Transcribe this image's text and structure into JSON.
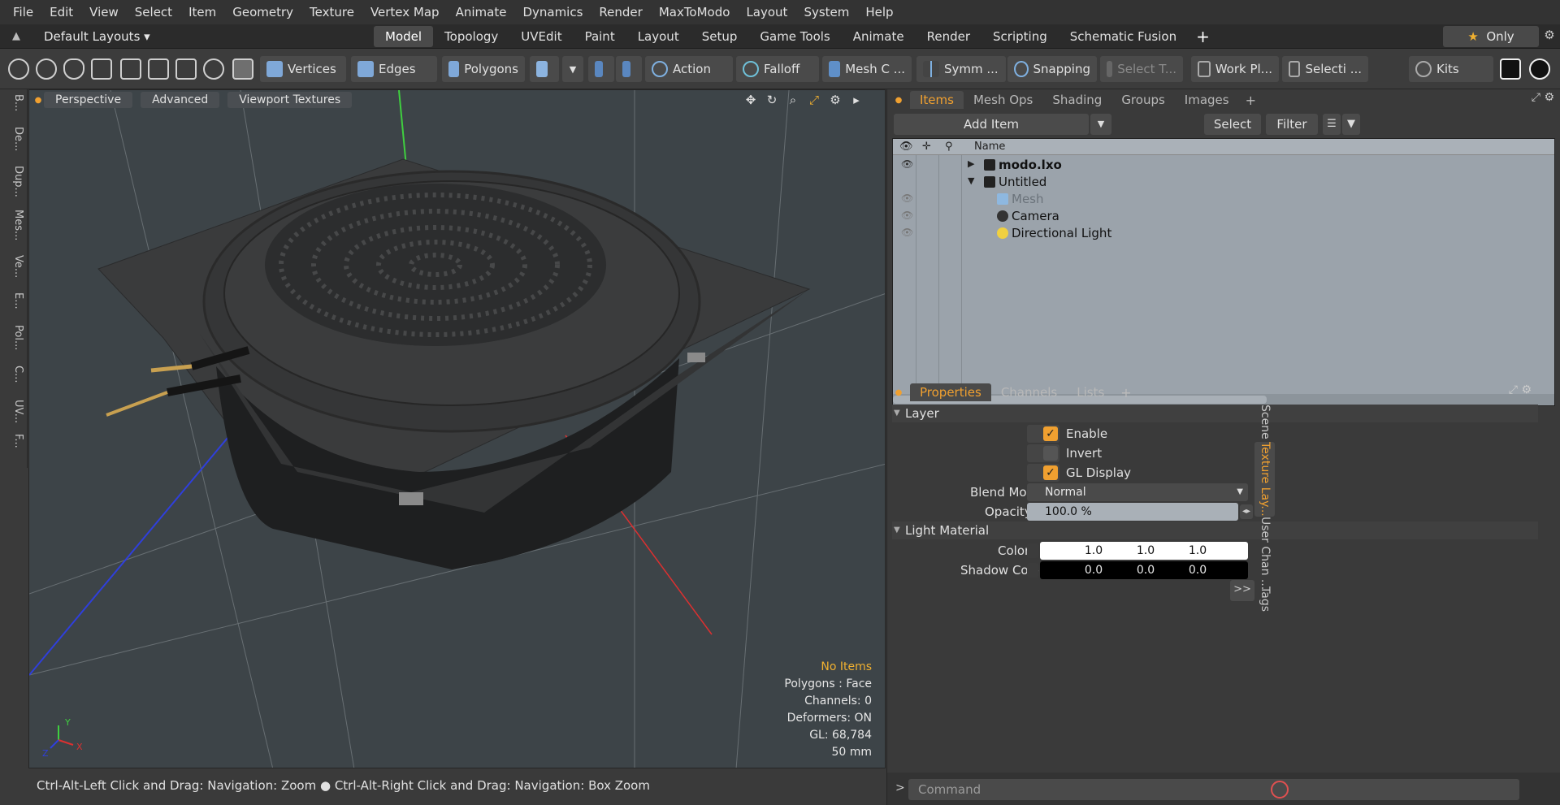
{
  "menu": [
    "File",
    "Edit",
    "View",
    "Select",
    "Item",
    "Geometry",
    "Texture",
    "Vertex Map",
    "Animate",
    "Dynamics",
    "Render",
    "MaxToModo",
    "Layout",
    "System",
    "Help"
  ],
  "layoutbar": {
    "layout_name": "Default Layouts ▾",
    "tabs": [
      "Model",
      "Topology",
      "UVEdit",
      "Paint",
      "Layout",
      "Setup",
      "Game Tools",
      "Animate",
      "Render",
      "Scripting",
      "Schematic Fusion"
    ],
    "active_tab": "Model",
    "plus": "+",
    "only_label": "Only",
    "only_star": "★"
  },
  "toolbar": {
    "vertices": "Vertices",
    "edges": "Edges",
    "polygons": "Polygons",
    "action": "Action",
    "falloff": "Falloff",
    "mesh_c": "Mesh C ...",
    "symm": "Symm ...",
    "snapping": "Snapping",
    "select_t": "Select T...",
    "work_pl": "Work Pl...",
    "selecti": "Selecti ...",
    "kits": "Kits"
  },
  "left_tabs": [
    "B...",
    "De...",
    "Dup...",
    "Mes...",
    "Ve...",
    "E...",
    "Pol...",
    "C...",
    "UV...",
    "F..."
  ],
  "viewport": {
    "header_buttons": [
      "Perspective",
      "Advanced",
      "Viewport Textures"
    ],
    "info_highlight": "No Items",
    "info_lines": [
      "Polygons : Face",
      "Channels: 0",
      "Deformers: ON",
      "GL: 68,784",
      "50 mm"
    ],
    "axis_labels": {
      "y": "Y",
      "x": "X",
      "z": "Z"
    }
  },
  "status": {
    "message": "Ctrl-Alt-Left Click and Drag: Navigation: Zoom ● Ctrl-Alt-Right Click and Drag: Navigation: Box Zoom"
  },
  "items_panel": {
    "tabs": [
      "Items",
      "Mesh Ops",
      "Shading",
      "Groups",
      "Images"
    ],
    "active_tab": "Items",
    "add_item": "Add Item",
    "select": "Select",
    "filter": "Filter",
    "column_name": "Name",
    "rows": [
      {
        "label": "modo.lxo",
        "bold": true
      },
      {
        "label": "Untitled",
        "bold": false
      },
      {
        "label": "Mesh",
        "bold": false
      },
      {
        "label": "Camera",
        "bold": false
      },
      {
        "label": "Directional Light",
        "bold": false
      }
    ]
  },
  "properties_panel": {
    "tabs": [
      "Properties",
      "Channels",
      "Lists"
    ],
    "active_tab": "Properties",
    "section_layer": "Layer",
    "enable": "Enable",
    "invert": "Invert",
    "gl_display": "GL Display",
    "blend_mode_label": "Blend Mode",
    "blend_mode_value": "Normal",
    "opacity_label": "Opacity",
    "opacity_value": "100.0 %",
    "section_light": "Light Material",
    "color_label": "Color",
    "color_values": [
      "1.0",
      "1.0",
      "1.0"
    ],
    "shadow_label": "Shadow Color",
    "shadow_values": [
      "0.0",
      "0.0",
      "0.0"
    ],
    "more": ">>",
    "side_tabs": [
      "Scene",
      "Texture Lay...",
      "User Chan ...",
      "Tags"
    ]
  },
  "command": {
    "prompt": ">",
    "placeholder": "Command"
  },
  "colors": {
    "accent": "#f0a030",
    "viewport_bg": "#3d4448",
    "list_bg": "#9ba3ab"
  }
}
